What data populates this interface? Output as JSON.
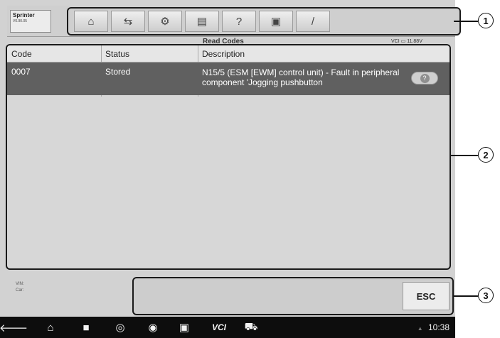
{
  "vehicle": {
    "name": "Sprinter",
    "version": "V0.90.05"
  },
  "toolbar": {
    "buttons": [
      {
        "icon": "home-icon",
        "glyph": "⌂"
      },
      {
        "icon": "vehicle-swap-icon",
        "glyph": "⇆"
      },
      {
        "icon": "settings-icon",
        "glyph": "⚙"
      },
      {
        "icon": "print-icon",
        "glyph": "▤"
      },
      {
        "icon": "help-icon",
        "glyph": "?"
      },
      {
        "icon": "save-icon",
        "glyph": "▣"
      },
      {
        "icon": "edit-icon",
        "glyph": "/"
      }
    ]
  },
  "screen_title": "Read Codes",
  "status_right": {
    "vci": "VCI",
    "battery": "11.88V"
  },
  "table": {
    "headers": [
      "Code",
      "Status",
      "Description"
    ],
    "rows": [
      {
        "code": "0007",
        "status": "Stored",
        "description": "N15/5 (ESM [EWM] control unit) - Fault in peripheral component 'Jogging pushbutton"
      }
    ],
    "row_action_glyph": "?"
  },
  "info": {
    "vin": "VIN:",
    "car": "Car:"
  },
  "function_bar": {
    "esc_label": "ESC"
  },
  "navbar": {
    "back": "🡐",
    "home": "⌂",
    "recent": "■",
    "browser": "◎",
    "camera": "◉",
    "display": "▣",
    "vci_label": "VCI",
    "car": "⛟",
    "time": "10:38"
  },
  "callouts": [
    "1",
    "2",
    "3"
  ]
}
